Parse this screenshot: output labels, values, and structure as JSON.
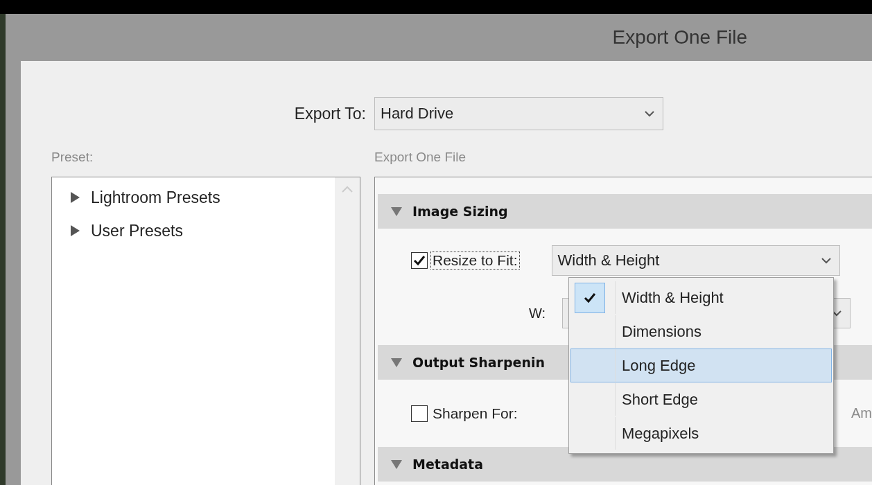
{
  "window": {
    "title": "Export One File"
  },
  "export_to": {
    "label": "Export To:",
    "value": "Hard Drive"
  },
  "preset": {
    "label": "Preset:",
    "items": [
      {
        "label": "Lightroom Presets",
        "expanded": false
      },
      {
        "label": "User Presets",
        "expanded": false
      }
    ]
  },
  "settings": {
    "label": "Export One File",
    "sections": [
      {
        "kind": "image_sizing",
        "title": "Image Sizing",
        "expanded": true,
        "resize": {
          "label": "Resize to Fit:",
          "checked": true,
          "value": "Width & Height"
        },
        "w_label": "W:"
      },
      {
        "kind": "output_sharpening",
        "title": "Output Sharpenin",
        "expanded": true,
        "sharpen": {
          "label": "Sharpen For:",
          "checked": false
        },
        "amount_label": "Am"
      },
      {
        "kind": "metadata",
        "title": "Metadata",
        "expanded": true
      }
    ]
  },
  "resize_menu": {
    "items": [
      {
        "label": "Width & Height",
        "checked": true,
        "selected": false
      },
      {
        "label": "Dimensions",
        "checked": false,
        "selected": false
      },
      {
        "label": "Long Edge",
        "checked": false,
        "selected": true
      },
      {
        "label": "Short Edge",
        "checked": false,
        "selected": false
      },
      {
        "label": "Megapixels",
        "checked": false,
        "selected": false
      }
    ]
  }
}
